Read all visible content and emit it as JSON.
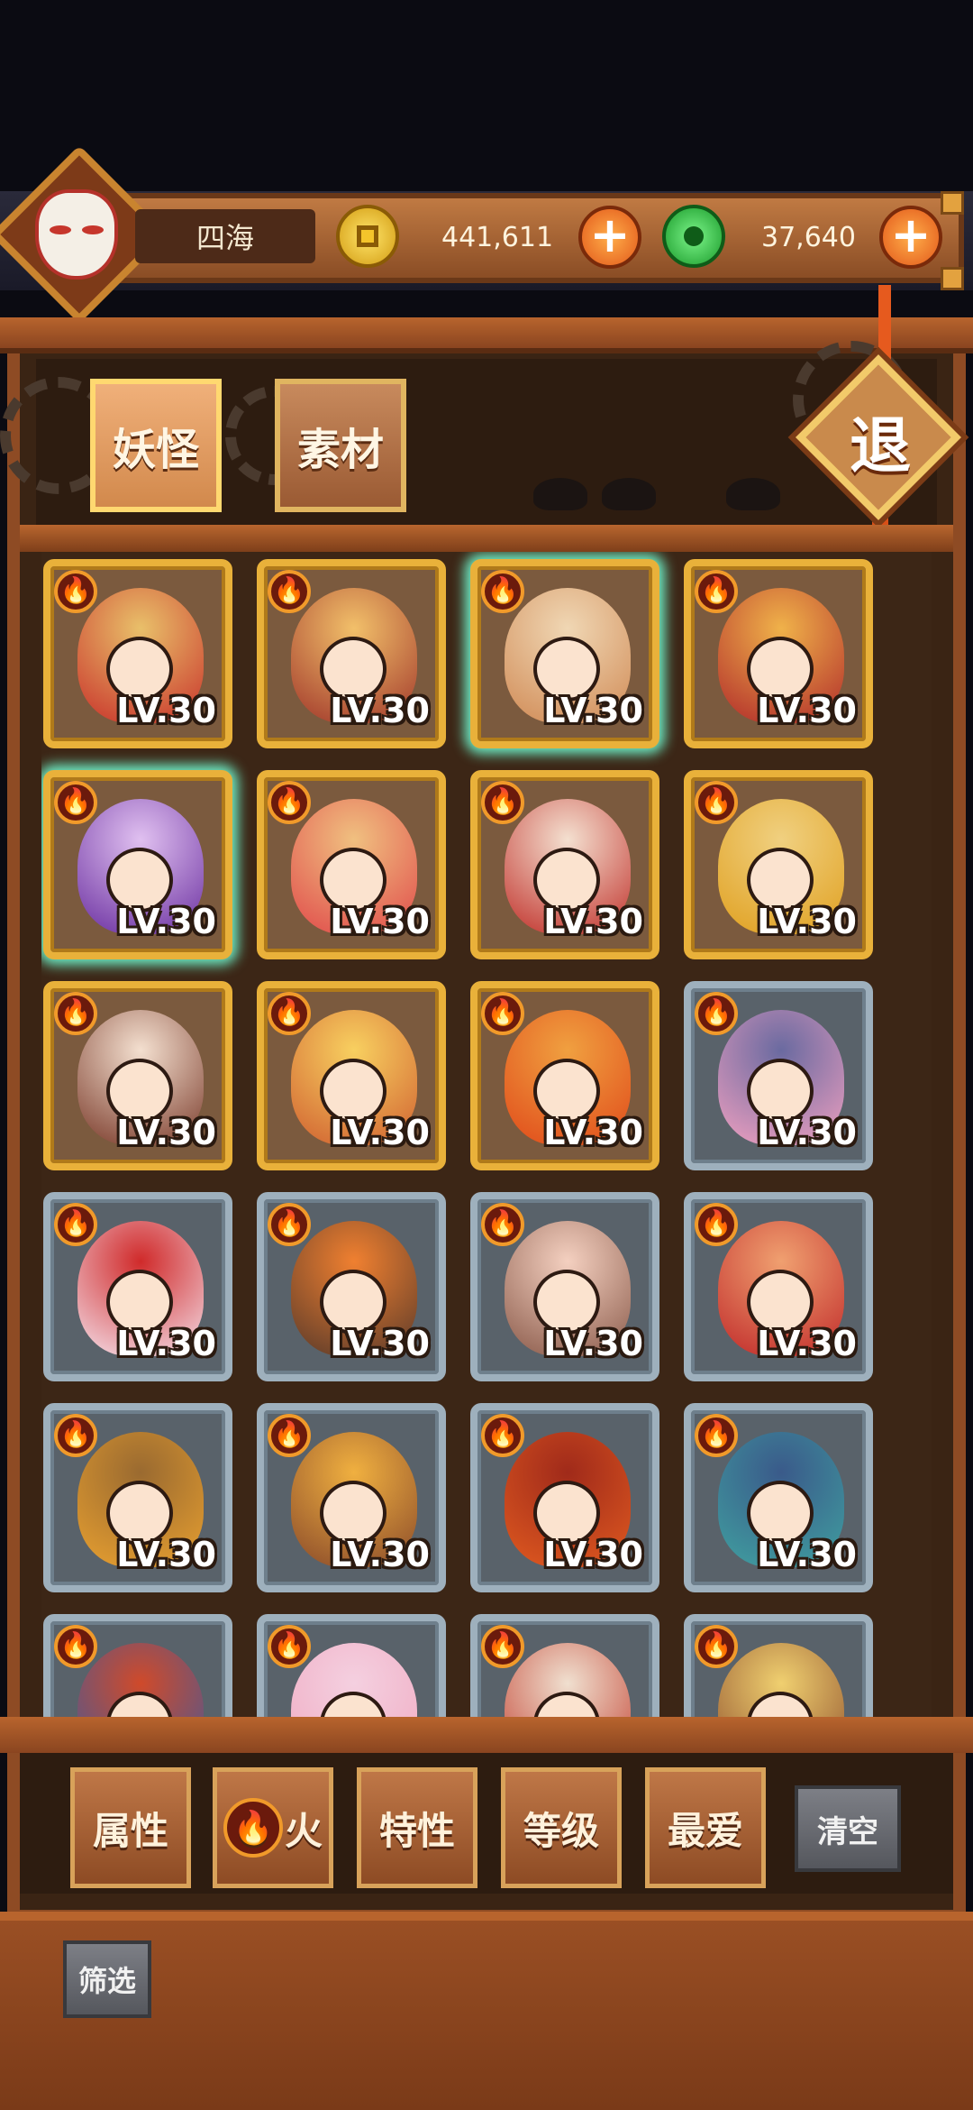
{
  "header": {
    "player_name": "四海",
    "gold_amount": "441,611",
    "jade_amount": "37,640",
    "plus_symbol": "+",
    "retreat_label": "退"
  },
  "tabs": [
    {
      "label": "妖怪",
      "active": true
    },
    {
      "label": "素材",
      "active": false
    }
  ],
  "cards": [
    {
      "level": "LV.30",
      "frame": "gold",
      "element": "fire",
      "glow": false
    },
    {
      "level": "LV.30",
      "frame": "gold",
      "element": "fire",
      "glow": false
    },
    {
      "level": "LV.30",
      "frame": "gold",
      "element": "fire",
      "glow": true
    },
    {
      "level": "LV.30",
      "frame": "gold",
      "element": "fire",
      "glow": false
    },
    {
      "level": "LV.30",
      "frame": "gold",
      "element": "fire",
      "glow": true
    },
    {
      "level": "LV.30",
      "frame": "gold",
      "element": "fire",
      "glow": false
    },
    {
      "level": "LV.30",
      "frame": "gold",
      "element": "fire",
      "glow": false
    },
    {
      "level": "LV.30",
      "frame": "gold",
      "element": "fire",
      "glow": false
    },
    {
      "level": "LV.30",
      "frame": "gold",
      "element": "fire",
      "glow": false
    },
    {
      "level": "LV.30",
      "frame": "gold",
      "element": "fire",
      "glow": false
    },
    {
      "level": "LV.30",
      "frame": "gold",
      "element": "fire",
      "glow": false
    },
    {
      "level": "LV.30",
      "frame": "silver",
      "element": "fire",
      "glow": false
    },
    {
      "level": "LV.30",
      "frame": "silver",
      "element": "fire",
      "glow": false
    },
    {
      "level": "LV.30",
      "frame": "silver",
      "element": "fire",
      "glow": false
    },
    {
      "level": "LV.30",
      "frame": "silver",
      "element": "fire",
      "glow": false
    },
    {
      "level": "LV.30",
      "frame": "silver",
      "element": "fire",
      "glow": false
    },
    {
      "level": "LV.30",
      "frame": "silver",
      "element": "fire",
      "glow": false
    },
    {
      "level": "LV.30",
      "frame": "silver",
      "element": "fire",
      "glow": false
    },
    {
      "level": "LV.30",
      "frame": "silver",
      "element": "fire",
      "glow": false
    },
    {
      "level": "LV.30",
      "frame": "silver",
      "element": "fire",
      "glow": false
    },
    {
      "level": "",
      "frame": "silver",
      "element": "fire",
      "glow": false
    },
    {
      "level": "",
      "frame": "silver",
      "element": "fire",
      "glow": false
    },
    {
      "level": "",
      "frame": "silver",
      "element": "fire",
      "glow": false
    },
    {
      "level": "",
      "frame": "silver",
      "element": "fire",
      "glow": false
    }
  ],
  "filters": {
    "attribute_label": "属性",
    "element_label": "火",
    "trait_label": "特性",
    "level_label": "等级",
    "favorite_label": "最爱",
    "clear_label": "清空",
    "filter_label": "筛选"
  },
  "colors": {
    "gold_frame": "#e9b13a",
    "silver_frame": "#9eb0bd",
    "fire": "#f19a2a",
    "wood": "#8e4b24"
  }
}
